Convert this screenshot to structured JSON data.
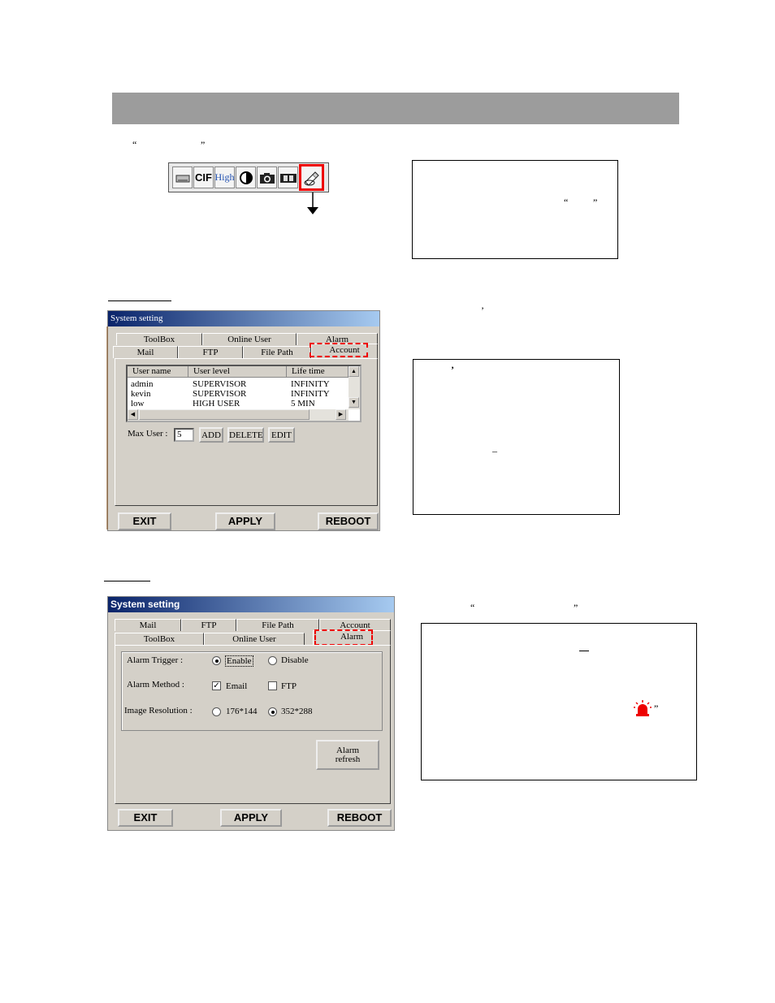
{
  "page": {
    "marks": {
      "quote_open": "“",
      "quote_close": "”",
      "apostrophe": "’",
      "dash": "–"
    }
  },
  "toolbar": {
    "buttons": [
      {
        "icon": "drive-icon"
      },
      {
        "icon": "cif-icon",
        "label": "CIF"
      },
      {
        "icon": "high-quality-icon",
        "label": "High"
      },
      {
        "icon": "contrast-icon"
      },
      {
        "icon": "camera-icon"
      },
      {
        "icon": "film-icon"
      },
      {
        "icon": "settings-pen-icon",
        "selected": true
      }
    ],
    "highlight_color": "#e00000"
  },
  "dialog1": {
    "title": "System setting",
    "tabs_row1": [
      "ToolBox",
      "Online User",
      "Alarm"
    ],
    "tabs_row2": [
      "Mail",
      "FTP",
      "File Path",
      "Account"
    ],
    "active_tab": "Account",
    "list_headers": [
      "User name",
      "User level",
      "Life time"
    ],
    "rows": [
      [
        "admin",
        "SUPERVISOR",
        "INFINITY"
      ],
      [
        "kevin",
        "SUPERVISOR",
        "INFINITY"
      ],
      [
        "low",
        "HIGH USER",
        "5 MIN"
      ]
    ],
    "max_user_label": "Max User :",
    "max_user_value": "5",
    "add_label": "ADD",
    "delete_label": "DELETE",
    "edit_label": "EDIT",
    "exit_label": "EXIT",
    "apply_label": "APPLY",
    "reboot_label": "REBOOT"
  },
  "dialog2": {
    "title": "System setting",
    "tabs_row1": [
      "Mail",
      "FTP",
      "File Path",
      "Account"
    ],
    "tabs_row2": [
      "ToolBox",
      "Online User",
      "Alarm"
    ],
    "active_tab": "Alarm",
    "alarm_trigger_label": "Alarm Trigger :",
    "enable_label": "Enable",
    "disable_label": "Disable",
    "alarm_trigger_selected": "Enable",
    "alarm_method_label": "Alarm Method :",
    "email_label": "Email",
    "ftp_label": "FTP",
    "email_checked": true,
    "ftp_checked": false,
    "resolution_label": "Image Resolution :",
    "res1_label": "176*144",
    "res2_label": "352*288",
    "resolution_selected": "352*288",
    "alarm_refresh_line1": "Alarm",
    "alarm_refresh_line2": "refresh",
    "exit_label": "EXIT",
    "apply_label": "APPLY",
    "reboot_label": "REBOOT"
  },
  "alarm_light_icon": "red-alarm-light-icon"
}
